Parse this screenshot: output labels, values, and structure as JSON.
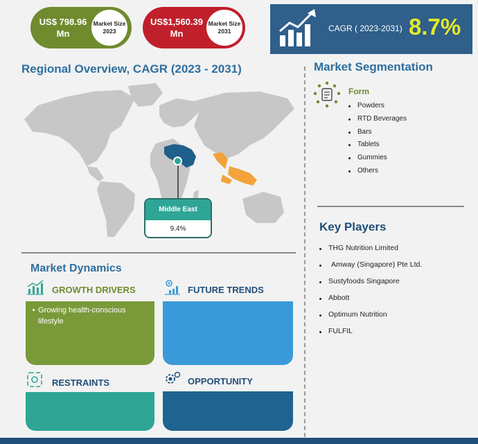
{
  "header": {
    "market_2023": {
      "value": "US$ 798.96 Mn",
      "label": "Market Size 2023",
      "color": "#6f8b2e"
    },
    "market_2031": {
      "value": "US$1,560.39 Mn",
      "label": "Market Size 2031",
      "color": "#c0202b"
    },
    "cagr_label": "CAGR ( 2023-2031)",
    "cagr_value": "8.7%",
    "cagr_color": "#e5e82a"
  },
  "regional": {
    "title": "Regional Overview, CAGR (2023 - 2031)",
    "callout_region": "Middle East",
    "callout_value": "9.4%"
  },
  "segmentation": {
    "title": "Market Segmentation",
    "category": "Form",
    "items": [
      "Powders",
      "RTD Beverages",
      "Bars",
      "Tablets",
      "Gummies",
      "Others"
    ]
  },
  "key_players": {
    "title": "Key Players",
    "items": [
      "THG Nutrition Limited",
      "Amway (Singapore) Pte Ltd.",
      "Sustyfoods Singapore",
      "Abbott",
      "Optimum Nutrition",
      "FULFIL"
    ]
  },
  "dynamics": {
    "title": "Market Dynamics",
    "growth_drivers": {
      "title": "GROWTH DRIVERS",
      "text": "Growing health-conscious lifestyle",
      "color": "#7a9a3a"
    },
    "future_trends": {
      "title": "FUTURE TRENDS",
      "color": "#3a9ad9"
    },
    "restraints": {
      "title": "RESTRAINTS",
      "color": "#2fa596"
    },
    "opportunity": {
      "title": "OPPORTUNITY",
      "color": "#1f6390"
    }
  }
}
